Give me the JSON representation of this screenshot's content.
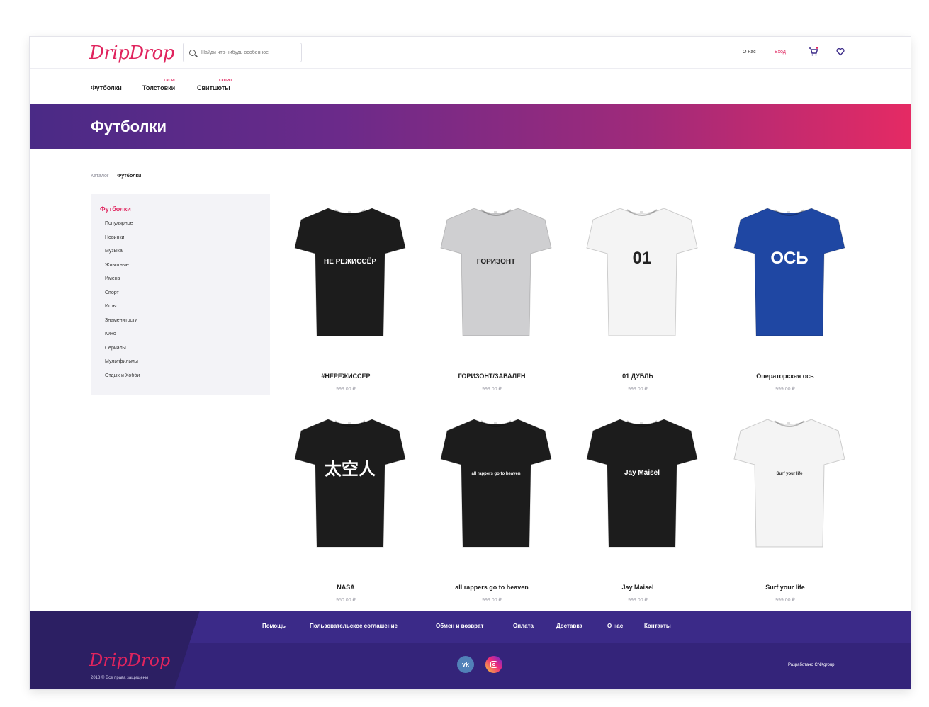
{
  "header": {
    "logo": "DripDrop",
    "search_placeholder": "Найди что-нибудь особенное",
    "about": "О нас",
    "login": "Вход"
  },
  "nav": {
    "items": [
      {
        "label": "Футболки",
        "badge": ""
      },
      {
        "label": "Толстовки",
        "badge": "СКОРО"
      },
      {
        "label": "Свитшоты",
        "badge": "СКОРО"
      }
    ]
  },
  "banner": {
    "title": "Футболки"
  },
  "breadcrumb": {
    "root": "Каталог",
    "current": "Футболки"
  },
  "sidebar": {
    "title": "Футболки",
    "items": [
      "Популярное",
      "Новинки",
      "Музыка",
      "Животные",
      "Имена",
      "Спорт",
      "Игры",
      "Знаменитости",
      "Кино",
      "Сериалы",
      "Мультфильмы",
      "Отдых и Хобби"
    ]
  },
  "products": [
    {
      "name": "#НЕРЕЖИССЁР",
      "price": "999.00 ₽",
      "shirt_color": "#1c1c1c",
      "print": "НЕ РЕЖИССЁР"
    },
    {
      "name": "ГОРИЗОНТ/ЗАВАЛЕН",
      "price": "999.00 ₽",
      "shirt_color": "#cfcfd1",
      "print": "ГОРИЗОНТ"
    },
    {
      "name": "01 ДУБЛЬ",
      "price": "999.00 ₽",
      "shirt_color": "#f4f4f4",
      "print": "01"
    },
    {
      "name": "Операторская ось",
      "price": "999.00 ₽",
      "shirt_color": "#1f47a3",
      "print": "ОСЬ"
    },
    {
      "name": "NASA",
      "price": "950.00 ₽",
      "shirt_color": "#1c1c1c",
      "print": "太空人"
    },
    {
      "name": "all rappers go to heaven",
      "price": "999.00 ₽",
      "shirt_color": "#1c1c1c",
      "print": "all rappers go to heaven"
    },
    {
      "name": "Jay Maisel",
      "price": "999.00 ₽",
      "shirt_color": "#1c1c1c",
      "print": "Jay Maisel"
    },
    {
      "name": "Surf your life",
      "price": "999.00 ₽",
      "shirt_color": "#f4f4f4",
      "print": "Surf your life"
    }
  ],
  "footer": {
    "links": [
      "Помощь",
      "Пользовательское соглашение",
      "Обмен и возврат",
      "Оплата",
      "Доставка",
      "О нас",
      "Контакты"
    ],
    "logo": "DripDrop",
    "copyright": "2018 © Все права защищены",
    "vk": "vk",
    "developed_prefix": "Разработано",
    "developer": "CNKgroup"
  },
  "colors": {
    "accent": "#e0245e",
    "footer": "#34247a",
    "banner_start": "#4a2a86",
    "banner_end": "#e52a64"
  }
}
